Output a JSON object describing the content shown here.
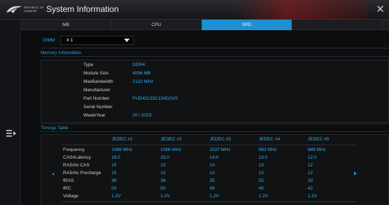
{
  "window": {
    "brand": "REPUBLIC OF GAMERS",
    "title": "System Information",
    "close_symbol": "✕"
  },
  "tabs": [
    {
      "label": "MB",
      "active": false
    },
    {
      "label": "CPU",
      "active": false
    },
    {
      "label": "SPD",
      "active": true
    },
    {
      "label": "",
      "active": false
    }
  ],
  "dimm": {
    "label": "DIMM",
    "selected": "# 1"
  },
  "memory_info": {
    "title": "Memory Information",
    "rows": [
      {
        "key": "Type",
        "value": "DDR4"
      },
      {
        "key": "Module Size",
        "value": "4096 MB"
      },
      {
        "key": "MaxBandwidth",
        "value": "2132 MHz"
      },
      {
        "key": "Manufacturer",
        "value": ""
      },
      {
        "key": "Part Number",
        "value": "PUD42133C154G2VS"
      },
      {
        "key": "Serial Number",
        "value": ""
      },
      {
        "key": "Week/Year",
        "value": "20 / 2015"
      }
    ]
  },
  "timings": {
    "title": "Timings Table",
    "columns": [
      "JEDEC #1",
      "JEDEC #2",
      "JEDEC #3",
      "JEDEC #4",
      "JEDEC #5"
    ],
    "rows": [
      {
        "label": "Frequency",
        "values": [
          "1066 MHz",
          "1066 MHz",
          "1037 MHz",
          "963 MHz",
          "888 MHz"
        ]
      },
      {
        "label": "CAS#Latency",
        "values": [
          "16.0",
          "15.0",
          "14.0",
          "13.0",
          "12.0"
        ]
      },
      {
        "label": "RAS#to CAS",
        "values": [
          "15",
          "15",
          "14",
          "13",
          "12"
        ]
      },
      {
        "label": "RAS#to Precharge",
        "values": [
          "15",
          "15",
          "14",
          "13",
          "12"
        ]
      },
      {
        "label": "tRAS",
        "values": [
          "36",
          "36",
          "35",
          "32",
          "30"
        ]
      },
      {
        "label": "tRC",
        "values": [
          "50",
          "50",
          "49",
          "45",
          "42"
        ]
      },
      {
        "label": "Voltage",
        "values": [
          "1.2V",
          "1.2V",
          "1.2V",
          "1.2V",
          "1.2V"
        ]
      }
    ]
  },
  "colors": {
    "accent": "#1f8fd2",
    "value_text": "#33b3ee",
    "background": "#0c0d0f"
  }
}
